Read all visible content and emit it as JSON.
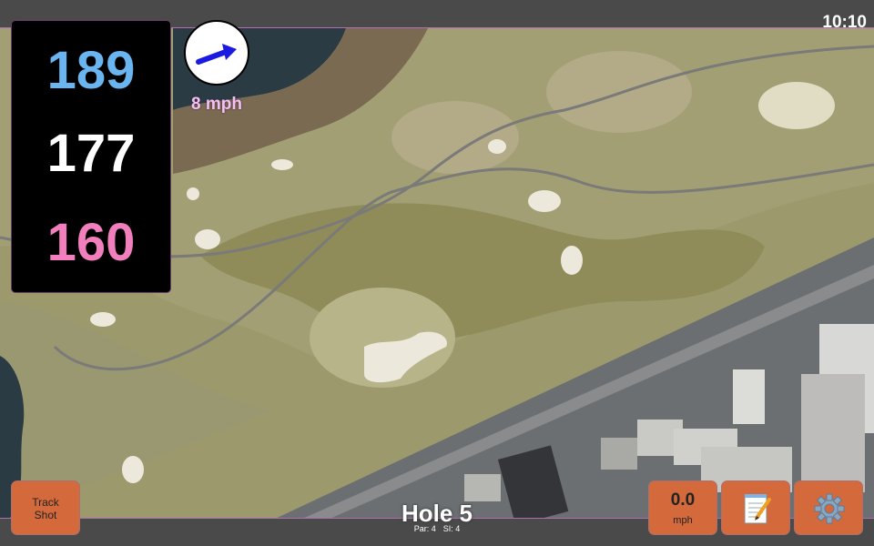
{
  "status_bar": {
    "time": "10:10"
  },
  "distances": {
    "back": "189",
    "middle": "177",
    "front": "160"
  },
  "wind": {
    "speed_label": "8 mph",
    "direction_icon": "arrow-icon",
    "arrow_color": "#1a1ae0"
  },
  "hole": {
    "title": "Hole 5",
    "par": "Par: 4",
    "stroke_index": "SI: 4"
  },
  "buttons": {
    "track_shot": "Track Shot",
    "wind_value": "0.0",
    "wind_unit": "mph",
    "notes_icon": "notepad-icon",
    "settings_icon": "gear-icon"
  },
  "colors": {
    "back": "#6ab4f0",
    "middle": "#ffffff",
    "front": "#f27fbd",
    "button": "#d46a3c"
  }
}
